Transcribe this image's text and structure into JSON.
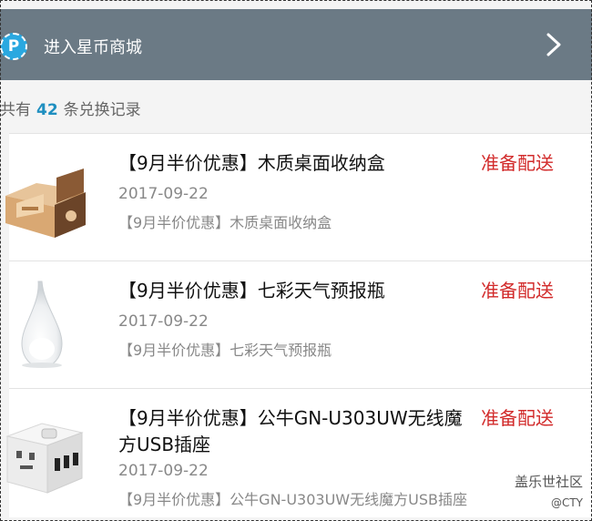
{
  "banner": {
    "icon_letter": "P",
    "title": "进入星币商城"
  },
  "summary": {
    "prefix": "共有",
    "count": "42",
    "suffix": "条兑换记录"
  },
  "items": [
    {
      "title": "【9月半价优惠】木质桌面收纳盒",
      "status": "准备配送",
      "date": "2017-09-22",
      "desc": "【9月半价优惠】木质桌面收纳盒"
    },
    {
      "title": "【9月半价优惠】七彩天气预报瓶",
      "status": "准备配送",
      "date": "2017-09-22",
      "desc": "【9月半价优惠】七彩天气预报瓶"
    },
    {
      "title": "【9月半价优惠】公牛GN-U303UW无线魔方USB插座",
      "status": "准备配送",
      "date": "2017-09-22",
      "desc": "【9月半价优惠】公牛GN-U303UW无线魔方USB插座"
    }
  ],
  "watermark": {
    "line1": "盖乐世社区",
    "line2": "@CTY"
  }
}
